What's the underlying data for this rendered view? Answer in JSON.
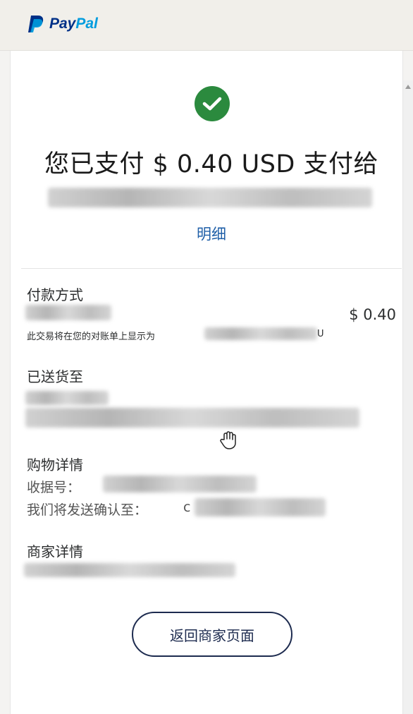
{
  "brand": {
    "logo_pay": "Pay",
    "logo_pal": "Pal",
    "colors": {
      "pay": "#003087",
      "pal": "#009cde",
      "success": "#2b8a3e",
      "link": "#1f5fa8",
      "button_border": "#1d2b4f"
    }
  },
  "confirmation": {
    "icon": "check-circle-icon",
    "headline": "您已支付 $ 0.40 USD 支付给",
    "details_link": "明细"
  },
  "payment_method": {
    "label": "付款方式",
    "amount": "$ 0.40",
    "statement_note": "此交易将在您的对账单上显示为",
    "statement_suffix": "U"
  },
  "shipping": {
    "label": "已送货至"
  },
  "purchase": {
    "label": "购物详情",
    "receipt_label": "收据号：",
    "confirm_label": "我们将发送确认至：",
    "confirm_prefix": "c"
  },
  "merchant": {
    "label": "商家详情"
  },
  "actions": {
    "return_button": "返回商家页面"
  }
}
